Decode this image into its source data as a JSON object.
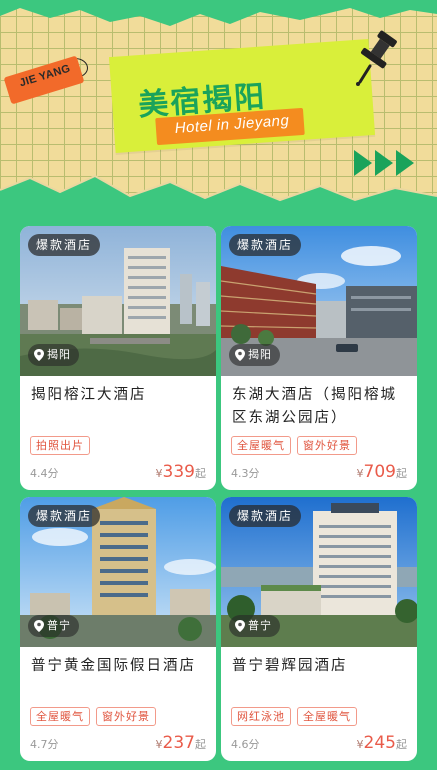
{
  "header": {
    "tag_text": "JIE YANG",
    "title": "美宿揭阳",
    "subtitle": "Hotel in Jieyang"
  },
  "colors": {
    "background": "#3cc77f",
    "accent_green": "#1aa35b",
    "title_card": "#d9ef3a",
    "orange": "#f48c1f",
    "price_red": "#e95b4a"
  },
  "hotels": [
    {
      "badge": "爆款酒店",
      "location": "揭阳",
      "name": "揭阳榕江大酒店",
      "tags": [
        "拍照出片"
      ],
      "score": "4.4分",
      "currency": "¥",
      "price": "339",
      "price_unit": "起"
    },
    {
      "badge": "爆款酒店",
      "location": "揭阳",
      "name": "东湖大酒店（揭阳榕城区东湖公园店）",
      "tags": [
        "全屋暖气",
        "窗外好景"
      ],
      "score": "4.3分",
      "currency": "¥",
      "price": "709",
      "price_unit": "起"
    },
    {
      "badge": "爆款酒店",
      "location": "普宁",
      "name": "普宁黄金国际假日酒店",
      "tags": [
        "全屋暖气",
        "窗外好景"
      ],
      "score": "4.7分",
      "currency": "¥",
      "price": "237",
      "price_unit": "起"
    },
    {
      "badge": "爆款酒店",
      "location": "普宁",
      "name": "普宁碧辉园酒店",
      "tags": [
        "网红泳池",
        "全屋暖气"
      ],
      "score": "4.6分",
      "currency": "¥",
      "price": "245",
      "price_unit": "起"
    }
  ]
}
